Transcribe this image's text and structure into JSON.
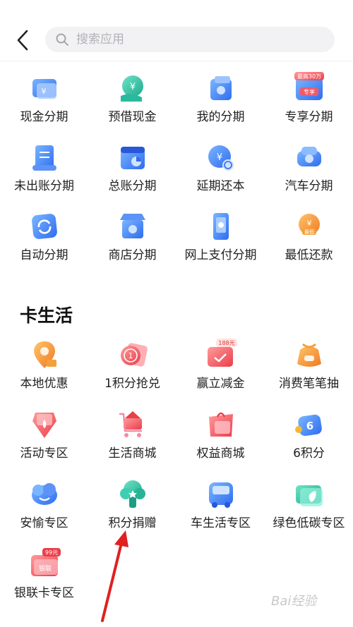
{
  "header": {
    "search_placeholder": "搜索应用"
  },
  "installment": [
    {
      "label": "现金分期",
      "icon": "cash-card-icon"
    },
    {
      "label": "预借现金",
      "icon": "yuan-hand-icon"
    },
    {
      "label": "我的分期",
      "icon": "wallet-icon"
    },
    {
      "label": "专享分期",
      "icon": "exclusive-badge-icon",
      "badge": "最高30万"
    },
    {
      "label": "未出账分期",
      "icon": "bill-scroll-icon"
    },
    {
      "label": "总账分期",
      "icon": "calendar-chart-icon"
    },
    {
      "label": "延期还本",
      "icon": "yuan-clock-icon"
    },
    {
      "label": "汽车分期",
      "icon": "car-icon"
    },
    {
      "label": "自动分期",
      "icon": "auto-refresh-icon"
    },
    {
      "label": "商店分期",
      "icon": "store-icon"
    },
    {
      "label": "网上支付分期",
      "icon": "phone-pay-icon"
    },
    {
      "label": "最低还款",
      "icon": "minimum-repay-icon"
    }
  ],
  "card_life": {
    "title": "卡生活",
    "items": [
      {
        "label": "本地优惠",
        "icon": "location-pin-icon"
      },
      {
        "label": "1积分抢兑",
        "icon": "one-point-coin-icon"
      },
      {
        "label": "赢立减金",
        "icon": "coupon-icon",
        "badge": "188元"
      },
      {
        "label": "消费笔笔抽",
        "icon": "lucky-bag-icon"
      },
      {
        "label": "活动专区",
        "icon": "activity-tag-icon"
      },
      {
        "label": "生活商城",
        "icon": "shopping-cart-icon"
      },
      {
        "label": "权益商城",
        "icon": "gift-bag-icon"
      },
      {
        "label": "6积分",
        "icon": "six-points-icon"
      },
      {
        "label": "安愉专区",
        "icon": "cloud-smile-icon"
      },
      {
        "label": "积分捐赠",
        "icon": "tree-icon"
      },
      {
        "label": "车生活专区",
        "icon": "bus-icon"
      },
      {
        "label": "绿色低碳专区",
        "icon": "leaf-card-icon"
      },
      {
        "label": "银联卡专区",
        "icon": "unionpay-card-icon",
        "badge": "99元"
      }
    ]
  },
  "watermark": "Bai经验",
  "colors": {
    "blue": "#3f7cf5",
    "teal": "#2cc0a4",
    "orange": "#f28a2c",
    "red": "#f05a5a",
    "pink": "#f48aa0"
  }
}
